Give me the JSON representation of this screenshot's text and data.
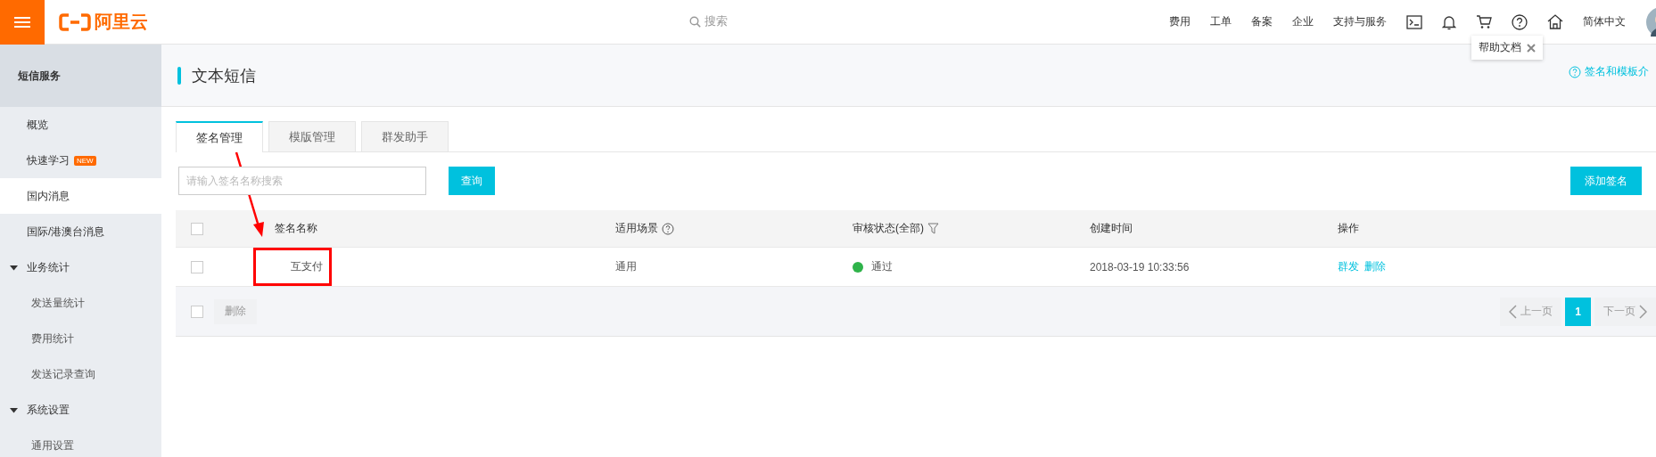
{
  "topbar": {
    "logo": "阿里云",
    "search_placeholder": "搜索",
    "nav": [
      {
        "kind": "text",
        "label": "费用"
      },
      {
        "kind": "text",
        "label": "工单"
      },
      {
        "kind": "text",
        "label": "备案"
      },
      {
        "kind": "text",
        "label": "企业"
      },
      {
        "kind": "text",
        "label": "支持与服务"
      },
      {
        "kind": "terminal"
      },
      {
        "kind": "bell"
      },
      {
        "kind": "cart"
      },
      {
        "kind": "help"
      },
      {
        "kind": "home"
      },
      {
        "kind": "text",
        "label": "简体中文"
      },
      {
        "kind": "avatar"
      }
    ],
    "tooltip": {
      "text": "帮助文档"
    }
  },
  "sidebar": {
    "title": "短信服务",
    "items": [
      {
        "label": "概览",
        "selected": false
      },
      {
        "label": "快速学习",
        "badge": "NEW",
        "selected": false
      },
      {
        "label": "国内消息",
        "selected": true
      },
      {
        "label": "国际/港澳台消息",
        "selected": false
      },
      {
        "label": "业务统计",
        "expanded": true,
        "children": [
          {
            "label": "发送量统计",
            "selected": false
          },
          {
            "label": "费用统计",
            "selected": false
          },
          {
            "label": "发送记录查询",
            "selected": false
          }
        ]
      },
      {
        "label": "系统设置",
        "expanded": true,
        "children": [
          {
            "label": "通用设置",
            "selected": false
          }
        ]
      }
    ]
  },
  "page": {
    "title": "文本短信",
    "help_link": "签名和模板介",
    "tabs": [
      {
        "label": "签名管理",
        "selected": true
      },
      {
        "label": "模版管理",
        "selected": false
      },
      {
        "label": "群发助手",
        "selected": false
      }
    ],
    "search": {
      "placeholder": "请输入签名名称搜索"
    },
    "query_button": "查询",
    "add_button": "添加签名",
    "table": {
      "columns": [
        {
          "label": "签名名称",
          "kind": "plain"
        },
        {
          "label": "适用场景",
          "kind": "help"
        },
        {
          "label": "审核状态(全部)",
          "kind": "filter"
        },
        {
          "label": "创建时间",
          "kind": "plain"
        },
        {
          "label": "操作",
          "kind": "plain"
        }
      ],
      "header_checked": false,
      "rows": [
        {
          "checked": false,
          "name": "互支付",
          "scene": "通用",
          "status": "通过",
          "color": "#2fb34a",
          "created": "2018-03-19 10:33:56",
          "actions": [
            "群发",
            "删除"
          ]
        }
      ],
      "footer": {
        "checked": false,
        "delete": "删除",
        "delete_disabled": true,
        "pagination": {
          "prev": "上一页",
          "prev_disabled": true,
          "pages": [
            {
              "label": "1",
              "selected": true
            }
          ],
          "next": "下一页",
          "next_disabled": true
        }
      }
    }
  }
}
